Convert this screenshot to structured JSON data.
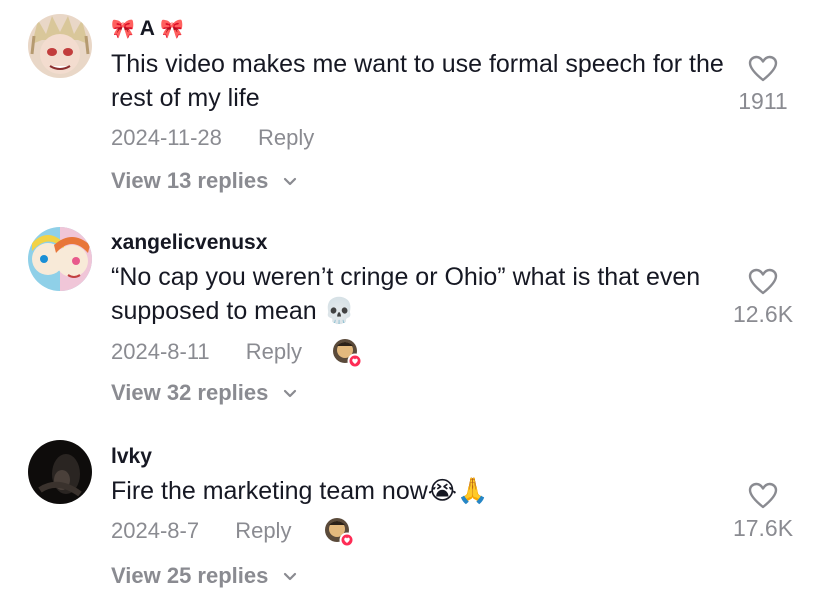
{
  "colors": {
    "text": "#161823",
    "muted": "#8a8b91",
    "like_badge": "#fe2c55"
  },
  "comments": [
    {
      "username": "A",
      "username_decoration": "🎀",
      "text": "This video makes me want to use formal speech for the rest of my life",
      "date": "2024-11-28",
      "reply_label": "Reply",
      "likes": "1911",
      "creator_liked": false,
      "view_replies": "View 13 replies"
    },
    {
      "username": "xangelicvenusx",
      "text": "“No cap you weren’t cringe or Ohio” what is that even supposed to mean 💀",
      "date": "2024-8-11",
      "reply_label": "Reply",
      "likes": "12.6K",
      "creator_liked": true,
      "view_replies": "View 32 replies"
    },
    {
      "username": "lvky",
      "text": "Fire the marketing team now😭🙏",
      "date": "2024-8-7",
      "reply_label": "Reply",
      "likes": "17.6K",
      "creator_liked": true,
      "view_replies": "View 25 replies"
    }
  ]
}
